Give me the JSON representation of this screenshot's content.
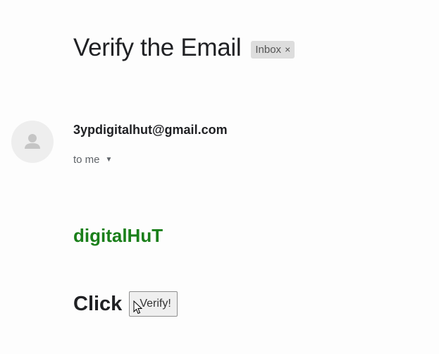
{
  "email": {
    "subject": "Verify the Email",
    "label": {
      "text": "Inbox",
      "close_glyph": "×",
      "close_icon": "close-icon"
    },
    "sender": {
      "address": "3ypdigitalhut@gmail.com",
      "avatar_icon": "person-icon"
    },
    "recipient": {
      "text": "to me",
      "caret_glyph": "▼",
      "caret_icon": "caret-down-icon"
    }
  },
  "body": {
    "brand": "digitalHuT",
    "cta_text": "Click",
    "button_label": "Verify!"
  },
  "colors": {
    "brand_green": "#1a7f1a",
    "chip_bg": "#dddddd",
    "avatar_bg": "#eeeeee"
  }
}
